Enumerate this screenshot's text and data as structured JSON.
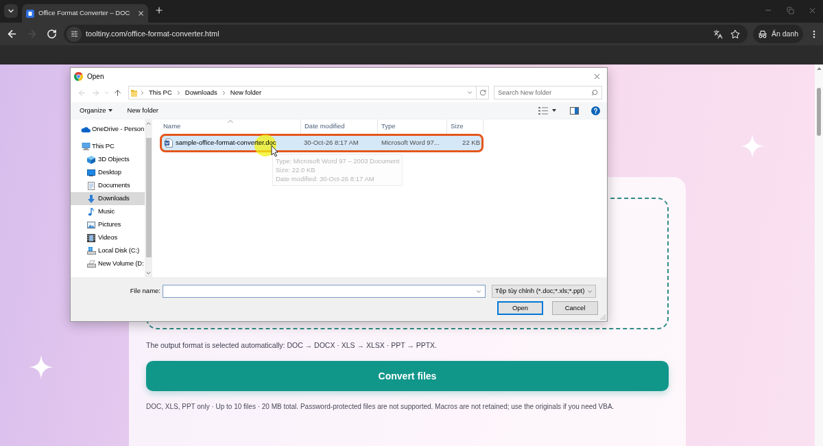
{
  "browser": {
    "tab": {
      "title": "Office Format Converter – DOC",
      "selected": true
    },
    "nav_buttons": [
      {
        "kind": "back",
        "disabled": false
      },
      {
        "kind": "forward",
        "disabled": true
      },
      {
        "kind": "reload",
        "disabled": false
      }
    ],
    "url": "tooltiny.com/office-format-converter.html",
    "profile": "Ẩn danh"
  },
  "page": {
    "output_note": "The output format is selected automatically: DOC → DOCX · XLS → XLSX · PPT → PPTX.",
    "convert_button": "Convert files",
    "limits_note": "DOC, XLS, PPT only · Up to 10 files · 20 MB total. Password-protected files are not supported. Macros are not retained; use the originals if you need VBA."
  },
  "dialog": {
    "title": "Open",
    "nav_buttons": [
      {
        "kind": "back",
        "disabled": true
      },
      {
        "kind": "forward",
        "disabled": true
      },
      {
        "kind": "recent",
        "disabled": true
      },
      {
        "kind": "up",
        "disabled": false
      }
    ],
    "breadcrumb": [
      "This PC",
      "Downloads",
      "New folder"
    ],
    "search_placeholder": "Search New folder",
    "toolbar": [
      {
        "label": "Organize",
        "kind": "menu"
      },
      {
        "label": "New folder",
        "kind": "button"
      }
    ],
    "nav_items": [
      {
        "label": "OneDrive - Person",
        "kind": "onedrive",
        "selected": false
      },
      {
        "label": "This PC",
        "kind": "pc",
        "selected": false,
        "children": [
          {
            "label": "3D Objects",
            "kind": "objects3d",
            "selected": false
          },
          {
            "label": "Desktop",
            "kind": "desktop",
            "selected": false
          },
          {
            "label": "Documents",
            "kind": "documents",
            "selected": false
          },
          {
            "label": "Downloads",
            "kind": "downloads",
            "selected": true
          },
          {
            "label": "Music",
            "kind": "music",
            "selected": false
          },
          {
            "label": "Pictures",
            "kind": "pictures",
            "selected": false
          },
          {
            "label": "Videos",
            "kind": "videos",
            "selected": false
          },
          {
            "label": "Local Disk (C:)",
            "kind": "disk",
            "selected": false
          },
          {
            "label": "New Volume (D:",
            "kind": "drive",
            "selected": false
          }
        ]
      }
    ],
    "columns": [
      {
        "label": "Name",
        "sorted": true
      },
      {
        "label": "Date modified",
        "sorted": false
      },
      {
        "label": "Type",
        "sorted": false
      },
      {
        "label": "Size",
        "sorted": false
      }
    ],
    "files": [
      {
        "name": "sample-office-format-converter.doc",
        "date_modified": "30-Oct-26 8:17 AM",
        "type": "Microsoft Word 97...",
        "size": "22 KB",
        "selected": true,
        "highlighted": true
      }
    ],
    "tooltip": [
      "Type: Microsoft Word 97 – 2003 Document",
      "Size: 22.0 KB",
      "Date modified: 30-Oct-26 8:17 AM"
    ],
    "file_name_label": "File name:",
    "file_type": "Tệp tùy chỉnh (*.doc;*.xls;*.ppt)",
    "buttons": [
      {
        "label": "Open",
        "kind": "default"
      },
      {
        "label": "Cancel",
        "kind": "normal"
      }
    ]
  }
}
